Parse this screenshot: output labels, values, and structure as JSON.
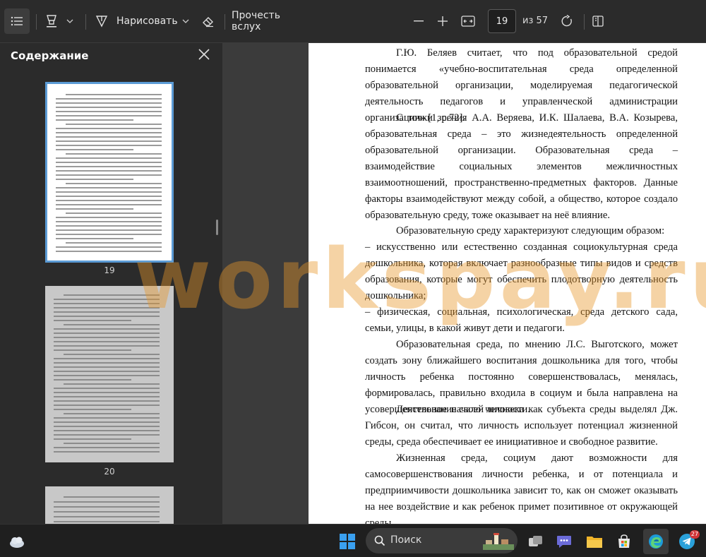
{
  "toolbar": {
    "draw_label": "Нарисовать",
    "read_aloud_label": "Прочесть вслух",
    "current_page": "19",
    "total_pages": "из 57"
  },
  "sidebar": {
    "title": "Содержание",
    "pages": [
      "19",
      "20"
    ]
  },
  "document": {
    "paragraphs": [
      "Г.Ю. Беляев считает, что под образовательной средой понимается «учебно-воспитательная среда определенной образовательной организации, моделируемая педагогической деятельность педагогов и управленческой администрации организации» [1, с.72].",
      "С точки зрения А.А. Веряева, И.К. Шалаева, В.А. Козырева, образовательная среда – это жизнедеятельность определенной образовательной организации. Образовательная среда – взаимодействие социальных элементов межличностных взаимоотношений, пространственно-предметных факторов. Данные факторы взаимодействуют между собой, а общество, которое создало образовательную среду, тоже оказывает на неё влияние.",
      "Образовательную среду характеризуют следующим образом:",
      "– искусственно или естественно созданная социокультурная среда дошкольника, которая включает разнообразные типы видов и средств образования, которые могут обеспечить плодотворную деятельность дошкольника;",
      "– физическая, социальная, психологическая, среда детского сада, семьи, улицы, в какой живут дети и педагоги.",
      "Образовательная среда, по мнению Л.С. Выготского, может создать зону ближайшего воспитания дошкольника для того, чтобы личность ребенка постоянно совершенствовалась, менялась, формировалась, правильно входила в социум и была направлена на усовершенствование своей личности.",
      "Деятельное начало человека как субъекта среды выделял Дж. Гибсон, он считал, что личность использует потенциал жизненной среды, среда обеспечивает ее инициативное и свободное развитие.",
      "Жизненная среда, социум дают возможности для самосовершенствования личности ребенка, и от потенциала и предприимчивости дошкольника зависит то, как он сможет оказывать на нее воздействие и как ребенок примет позитивное от окружающей среды."
    ]
  },
  "watermark": "workspay.ru",
  "taskbar": {
    "search_label": "Поиск",
    "telegram_badge": "27"
  },
  "colors": {
    "accent": "#5b9bd5",
    "toolbar_bg": "#2b2b2b",
    "watermark": "#e69628"
  }
}
